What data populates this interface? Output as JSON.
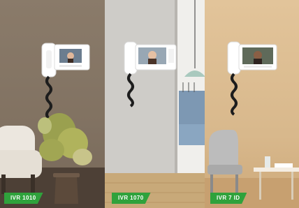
{
  "panels": [
    {
      "model": "IVR 1010"
    },
    {
      "model": "IVR 1070"
    },
    {
      "model": "IVR 7 ID"
    }
  ],
  "colors": {
    "label_bg": "#2fa23c",
    "label_text": "#ffffff",
    "wall_1": "#7e6f60",
    "wall_2": "#c8c5c0",
    "wall_3": "#d8b88c"
  },
  "icons": [
    "intercom-monitor-icon",
    "handset-icon",
    "plant-icon",
    "pendant-lamp-icon",
    "armchair-icon",
    "table-icon"
  ]
}
